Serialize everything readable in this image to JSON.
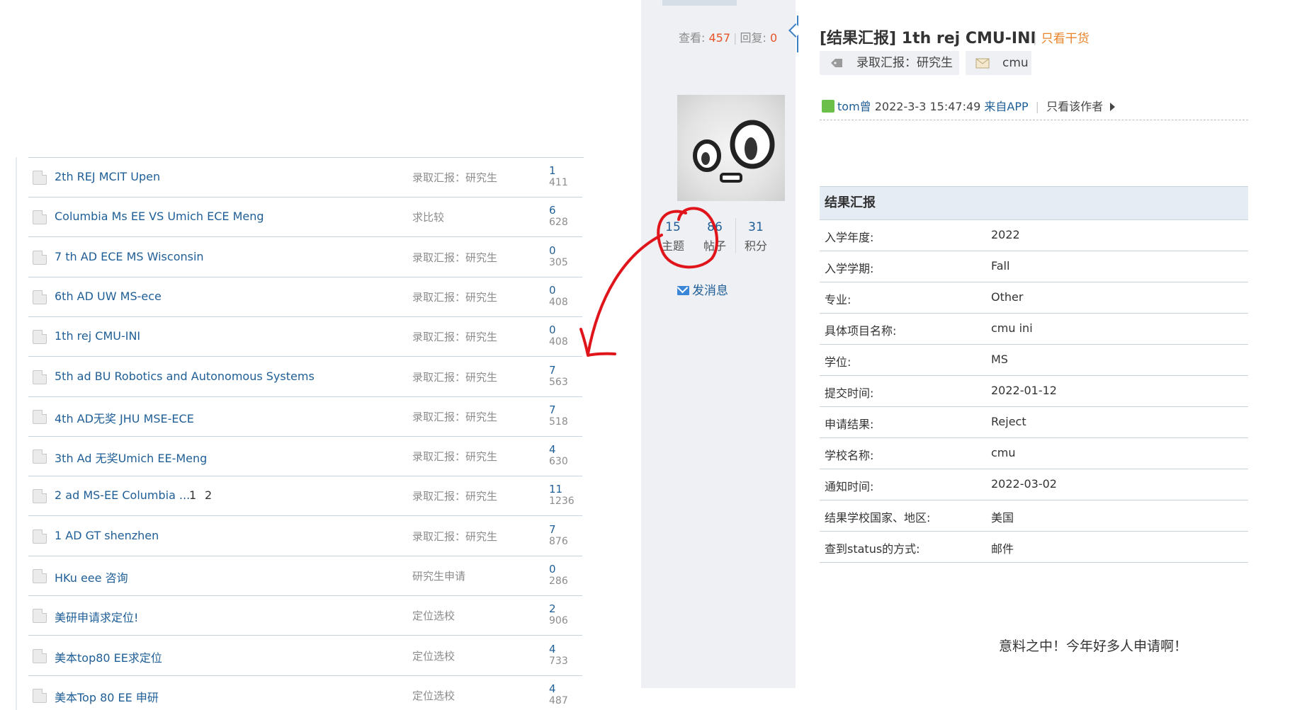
{
  "thread_list": [
    {
      "title": "2th REJ MCIT Upen",
      "pages": [],
      "category": "录取汇报：研究生",
      "replies": "1",
      "views": "411"
    },
    {
      "title": "Columbia Ms EE VS Umich ECE Meng",
      "pages": [],
      "category": "求比较",
      "replies": "6",
      "views": "628"
    },
    {
      "title": "7 th AD ECE MS Wisconsin",
      "pages": [],
      "category": "录取汇报：研究生",
      "replies": "0",
      "views": "305"
    },
    {
      "title": "6th AD UW MS-ece",
      "pages": [],
      "category": "录取汇报：研究生",
      "replies": "0",
      "views": "408"
    },
    {
      "title": "1th rej CMU-INI",
      "pages": [],
      "category": "录取汇报：研究生",
      "replies": "0",
      "views": "408"
    },
    {
      "title": "5th ad BU Robotics and Autonomous Systems",
      "pages": [],
      "category": "录取汇报：研究生",
      "replies": "7",
      "views": "563"
    },
    {
      "title": "4th AD无奖 JHU MSE-ECE",
      "pages": [],
      "category": "录取汇报：研究生",
      "replies": "7",
      "views": "518"
    },
    {
      "title": "3th Ad 无奖Umich EE-Meng",
      "pages": [],
      "category": "录取汇报：研究生",
      "replies": "4",
      "views": "630"
    },
    {
      "title": "2 ad MS-EE Columbia ...",
      "pages": [
        "1",
        "2"
      ],
      "category": "录取汇报：研究生",
      "replies": "11",
      "views": "1236"
    },
    {
      "title": "1 AD GT shenzhen",
      "pages": [],
      "category": "录取汇报：研究生",
      "replies": "7",
      "views": "876"
    },
    {
      "title": "HKu eee 咨询",
      "pages": [],
      "category": "研究生申请",
      "replies": "0",
      "views": "286"
    },
    {
      "title": "美研申请求定位!",
      "pages": [],
      "category": "定位选校",
      "replies": "2",
      "views": "906"
    },
    {
      "title": "美本top80 EE求定位",
      "pages": [],
      "category": "定位选校",
      "replies": "4",
      "views": "733"
    },
    {
      "title": "美本Top 80 EE 申研",
      "pages": [],
      "category": "定位选校",
      "replies": "4",
      "views": "487"
    }
  ],
  "thread": {
    "views_label": "查看:",
    "views": "457",
    "replies_label": "回复:",
    "replies": "0",
    "title": "[结果汇报] 1th rej CMU-INI",
    "only_goods": "只看干货",
    "tags": [
      {
        "icon": "tag-icon",
        "label": "录取汇报：研究生"
      },
      {
        "icon": "envelope-icon",
        "label": "cmu"
      }
    ]
  },
  "author": {
    "stats": [
      {
        "value": "15",
        "label": "主题"
      },
      {
        "value": "86",
        "label": "帖子"
      },
      {
        "value": "31",
        "label": "积分"
      }
    ],
    "message_label": "发消息"
  },
  "post": {
    "username": "tom曾",
    "datetime": "2022-3-3 15:47:49",
    "source": "来自APP",
    "only_author": "只看该作者",
    "info_header": "结果汇报",
    "info": [
      {
        "key": "入学年度:",
        "value": "2022"
      },
      {
        "key": "入学学期:",
        "value": "Fall"
      },
      {
        "key": "专业:",
        "value": "Other"
      },
      {
        "key": "具体项目名称:",
        "value": "cmu ini"
      },
      {
        "key": "学位:",
        "value": "MS"
      },
      {
        "key": "提交时间:",
        "value": "2022-01-12"
      },
      {
        "key": "申请结果:",
        "value": "Reject"
      },
      {
        "key": "学校名称:",
        "value": "cmu"
      },
      {
        "key": "通知时间:",
        "value": "2022-03-02"
      },
      {
        "key": "结果学校国家、地区:",
        "value": "美国"
      },
      {
        "key": "查到status的方式:",
        "value": "邮件"
      }
    ],
    "comment": "意料之中！今年好多人申请啊！"
  },
  "colors": {
    "link": "#1f5e96",
    "accent_orange": "#e8842a",
    "count_red": "#e8532a",
    "annotation_red": "#e0151b"
  }
}
